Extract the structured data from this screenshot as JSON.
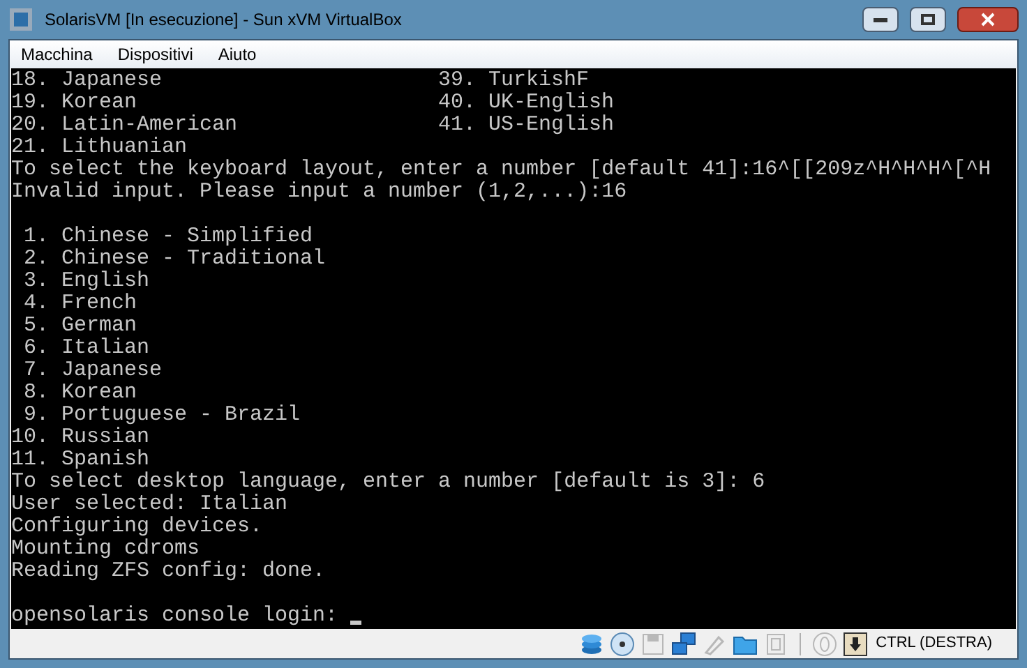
{
  "window": {
    "title": "SolarisVM [In esecuzione] - Sun xVM VirtualBox"
  },
  "menu": [
    "Macchina",
    "Dispositivi",
    "Aiuto"
  ],
  "console": {
    "lines": [
      {
        "kind": "columns",
        "cells": [
          "18. Japanese",
          "39. TurkishF"
        ]
      },
      {
        "kind": "columns",
        "cells": [
          "19. Korean",
          "40. UK-English"
        ]
      },
      {
        "kind": "columns",
        "cells": [
          "20. Latin-American",
          "41. US-English"
        ]
      },
      {
        "kind": "text",
        "text": "21. Lithuanian"
      },
      {
        "kind": "text",
        "text": "To select the keyboard layout, enter a number [default 41]:16^[[209z^H^H^H^[^H"
      },
      {
        "kind": "text",
        "text": "Invalid input. Please input a number (1,2,...):16"
      },
      {
        "kind": "blank"
      },
      {
        "kind": "text",
        "text": " 1. Chinese - Simplified"
      },
      {
        "kind": "text",
        "text": " 2. Chinese - Traditional"
      },
      {
        "kind": "text",
        "text": " 3. English"
      },
      {
        "kind": "text",
        "text": " 4. French"
      },
      {
        "kind": "text",
        "text": " 5. German"
      },
      {
        "kind": "text",
        "text": " 6. Italian"
      },
      {
        "kind": "text",
        "text": " 7. Japanese"
      },
      {
        "kind": "text",
        "text": " 8. Korean"
      },
      {
        "kind": "text",
        "text": " 9. Portuguese - Brazil"
      },
      {
        "kind": "text",
        "text": "10. Russian"
      },
      {
        "kind": "text",
        "text": "11. Spanish"
      },
      {
        "kind": "text",
        "text": "To select desktop language, enter a number [default is 3]: 6"
      },
      {
        "kind": "text",
        "text": "User selected: Italian"
      },
      {
        "kind": "text",
        "text": "Configuring devices."
      },
      {
        "kind": "text",
        "text": "Mounting cdroms"
      },
      {
        "kind": "text",
        "text": "Reading ZFS config: done."
      },
      {
        "kind": "blank"
      },
      {
        "kind": "prompt",
        "text": "opensolaris console login: "
      }
    ]
  },
  "status_bar": {
    "icons": [
      {
        "kind": "disk",
        "disabled": false
      },
      {
        "kind": "cd",
        "disabled": false
      },
      {
        "kind": "floppy",
        "disabled": true
      },
      {
        "kind": "network",
        "disabled": false
      },
      {
        "kind": "usb",
        "disabled": true
      },
      {
        "kind": "folder",
        "disabled": false
      },
      {
        "kind": "display",
        "disabled": true
      },
      {
        "kind": "separator",
        "disabled": false
      },
      {
        "kind": "mouse",
        "disabled": true
      },
      {
        "kind": "hostkey",
        "disabled": false
      }
    ],
    "host_key": "CTRL (DESTRA)"
  }
}
